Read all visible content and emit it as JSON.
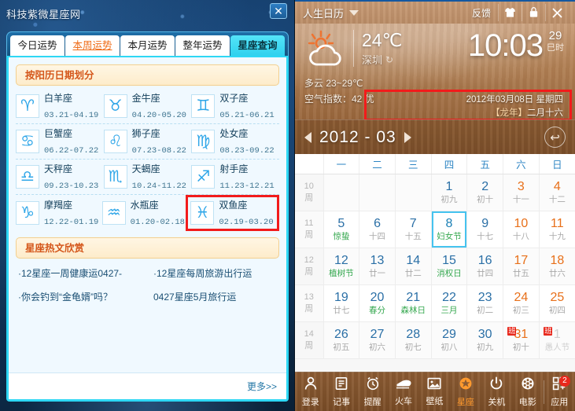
{
  "zodiac_window": {
    "title": "科技紫微星座网",
    "close_label": "✕",
    "tabs": [
      {
        "label": "今日运势",
        "state": "normal"
      },
      {
        "label": "本周运势",
        "state": "hover"
      },
      {
        "label": "本月运势",
        "state": "normal"
      },
      {
        "label": "整年运势",
        "state": "normal"
      },
      {
        "label": "星座查询",
        "state": "active"
      }
    ],
    "section_title": "按阳历日期划分",
    "signs": [
      {
        "name": "白羊座",
        "dates": "03.21-04.19",
        "glyph": "♈",
        "selected": false
      },
      {
        "name": "金牛座",
        "dates": "04.20-05.20",
        "glyph": "♉",
        "selected": false
      },
      {
        "name": "双子座",
        "dates": "05.21-06.21",
        "glyph": "♊",
        "selected": false
      },
      {
        "name": "巨蟹座",
        "dates": "06.22-07.22",
        "glyph": "♋",
        "selected": false
      },
      {
        "name": "狮子座",
        "dates": "07.23-08.22",
        "glyph": "♌",
        "selected": false
      },
      {
        "name": "处女座",
        "dates": "08.23-09.22",
        "glyph": "♍",
        "selected": false
      },
      {
        "name": "天秤座",
        "dates": "09.23-10.23",
        "glyph": "♎",
        "selected": false
      },
      {
        "name": "天蝎座",
        "dates": "10.24-11.22",
        "glyph": "♏",
        "selected": false
      },
      {
        "name": "射手座",
        "dates": "11.23-12.21",
        "glyph": "♐",
        "selected": false
      },
      {
        "name": "摩羯座",
        "dates": "12.22-01.19",
        "glyph": "♑",
        "selected": false
      },
      {
        "name": "水瓶座",
        "dates": "01.20-02.18",
        "glyph": "♒",
        "selected": false
      },
      {
        "name": "双鱼座",
        "dates": "02.19-03.20",
        "glyph": "♓",
        "selected": true
      }
    ],
    "hot_section_title": "星座热文欣赏",
    "hot_links": [
      [
        "·12星座一周健康运0427-",
        "·12星座每周旅游出行运"
      ],
      [
        "·你会钓到“金龟婿”吗？",
        "0427星座5月旅行运"
      ]
    ],
    "more_label": "更多>>"
  },
  "calendar_window": {
    "app_name": "人生日历",
    "feedback_label": "反馈",
    "title_icons": [
      {
        "name": "skin-icon",
        "glyph": "👕"
      },
      {
        "name": "minimize-icon",
        "glyph": "🔒"
      },
      {
        "name": "close-icon",
        "glyph": "✕"
      }
    ],
    "weather": {
      "icon": "sun-behind-cloud-icon",
      "temperature": "24℃",
      "city": "深圳",
      "refresh_icon": "↻",
      "condition": "多云 23~29℃",
      "air_quality": "空气指数：42 优"
    },
    "clock": {
      "time": "10:03",
      "day_number": "29",
      "shichen": "巳时"
    },
    "date_box": {
      "solar": "2012年03月08日  星期四",
      "lunar_year": "【龙年】",
      "lunar_date": "二月十六",
      "highlight_color": "#f21b1b"
    },
    "month_nav": {
      "prev": "◀",
      "label": "2012 - 03",
      "next": "▶",
      "today_icon": "↩"
    },
    "weekday_headers": [
      "",
      "一",
      "二",
      "三",
      "四",
      "五",
      "六",
      "日"
    ],
    "weeks": [
      {
        "week_no": "10",
        "week_unit": "周",
        "days": [
          {
            "num": "",
            "sub": "",
            "type": "empty"
          },
          {
            "num": "",
            "sub": "",
            "type": "empty"
          },
          {
            "num": "",
            "sub": "",
            "type": "empty"
          },
          {
            "num": "1",
            "sub": "初九",
            "type": "normal"
          },
          {
            "num": "2",
            "sub": "初十",
            "type": "normal"
          },
          {
            "num": "3",
            "sub": "十一",
            "type": "weekend"
          },
          {
            "num": "4",
            "sub": "十二",
            "type": "weekend"
          }
        ]
      },
      {
        "week_no": "11",
        "week_unit": "周",
        "days": [
          {
            "num": "5",
            "sub": "惊蛰",
            "type": "festival"
          },
          {
            "num": "6",
            "sub": "十四",
            "type": "normal"
          },
          {
            "num": "7",
            "sub": "十五",
            "type": "normal"
          },
          {
            "num": "8",
            "sub": "妇女节",
            "type": "festival",
            "today": true
          },
          {
            "num": "9",
            "sub": "十七",
            "type": "normal"
          },
          {
            "num": "10",
            "sub": "十八",
            "type": "weekend"
          },
          {
            "num": "11",
            "sub": "十九",
            "type": "weekend"
          }
        ]
      },
      {
        "week_no": "12",
        "week_unit": "周",
        "days": [
          {
            "num": "12",
            "sub": "植树节",
            "type": "festival"
          },
          {
            "num": "13",
            "sub": "廿一",
            "type": "normal"
          },
          {
            "num": "14",
            "sub": "廿二",
            "type": "normal"
          },
          {
            "num": "15",
            "sub": "消权日",
            "type": "festival"
          },
          {
            "num": "16",
            "sub": "廿四",
            "type": "normal"
          },
          {
            "num": "17",
            "sub": "廿五",
            "type": "weekend"
          },
          {
            "num": "18",
            "sub": "廿六",
            "type": "weekend"
          }
        ]
      },
      {
        "week_no": "13",
        "week_unit": "周",
        "days": [
          {
            "num": "19",
            "sub": "廿七",
            "type": "normal"
          },
          {
            "num": "20",
            "sub": "春分",
            "type": "festival"
          },
          {
            "num": "21",
            "sub": "森林日",
            "type": "festival"
          },
          {
            "num": "22",
            "sub": "三月",
            "type": "festival"
          },
          {
            "num": "23",
            "sub": "初二",
            "type": "normal"
          },
          {
            "num": "24",
            "sub": "初三",
            "type": "weekend"
          },
          {
            "num": "25",
            "sub": "初四",
            "type": "weekend"
          }
        ]
      },
      {
        "week_no": "14",
        "week_unit": "周",
        "days": [
          {
            "num": "26",
            "sub": "初五",
            "type": "normal"
          },
          {
            "num": "27",
            "sub": "初六",
            "type": "normal"
          },
          {
            "num": "28",
            "sub": "初七",
            "type": "normal"
          },
          {
            "num": "29",
            "sub": "初八",
            "type": "normal"
          },
          {
            "num": "30",
            "sub": "初九",
            "type": "normal"
          },
          {
            "num": "31",
            "sub": "初十",
            "type": "weekend",
            "badge": "班"
          },
          {
            "num": "1",
            "sub": "愚人节",
            "type": "other",
            "badge": "班"
          }
        ]
      }
    ],
    "dock": [
      {
        "label": "登录",
        "icon": "user-icon",
        "glyph": "👤",
        "active": false
      },
      {
        "label": "记事",
        "icon": "note-icon",
        "glyph": "📝",
        "active": false
      },
      {
        "label": "提醒",
        "icon": "alarm-icon",
        "glyph": "⏰",
        "active": false
      },
      {
        "label": "火车",
        "icon": "train-icon",
        "glyph": "🚄",
        "active": false
      },
      {
        "label": "壁纸",
        "icon": "wallpaper-icon",
        "glyph": "🖼",
        "active": false
      },
      {
        "label": "星座",
        "icon": "zodiac-icon",
        "glyph": "✹",
        "active": true
      },
      {
        "label": "关机",
        "icon": "power-icon",
        "glyph": "⏻",
        "active": false
      },
      {
        "label": "电影",
        "icon": "film-icon",
        "glyph": "🎞",
        "active": false
      },
      {
        "label": "应用",
        "icon": "apps-icon",
        "glyph": "⊞",
        "active": false,
        "badge": "2"
      }
    ]
  }
}
